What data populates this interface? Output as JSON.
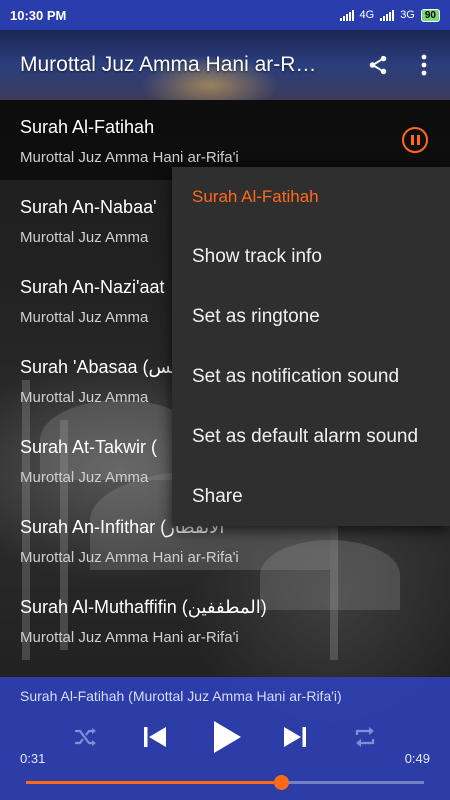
{
  "status_bar": {
    "time": "10:30 PM",
    "network_1": "4G",
    "network_2": "3G",
    "battery": "90"
  },
  "app_bar": {
    "title": "Murottal Juz Amma Hani ar-Rifa'i",
    "share_icon": "share-icon",
    "overflow_icon": "more-vert-icon"
  },
  "tracks": [
    {
      "title": "Surah Al-Fatihah",
      "subtitle": "Murottal Juz Amma Hani ar-Rifa'i"
    },
    {
      "title": "Surah An-Nabaa'",
      "subtitle": "Murottal Juz Amma"
    },
    {
      "title": "Surah An-Nazi'aat",
      "subtitle": "Murottal Juz Amma"
    },
    {
      "title": "Surah 'Abasaa (عبس",
      "subtitle": "Murottal Juz Amma"
    },
    {
      "title": "Surah At-Takwir (",
      "subtitle": "Murottal Juz Amma"
    },
    {
      "title": "Surah An-Infithar (الانفطار",
      "subtitle": "Murottal Juz Amma Hani ar-Rifa'i"
    },
    {
      "title": "Surah Al-Muthaffifin (المطففين)",
      "subtitle": "Murottal Juz Amma Hani ar-Rifa'i"
    }
  ],
  "context_menu": {
    "header": "Surah Al-Fatihah",
    "items": [
      "Show track info",
      "Set as ringtone",
      "Set as notification sound",
      "Set as default alarm sound",
      "Share"
    ]
  },
  "player": {
    "now_playing": "Surah Al-Fatihah (Murottal Juz Amma Hani ar-Rifa'i)",
    "elapsed": "0:31",
    "duration": "0:49",
    "progress_fraction": 0.64,
    "accent_color": "#ff6a1a",
    "bar_color": "#2e40b4"
  }
}
